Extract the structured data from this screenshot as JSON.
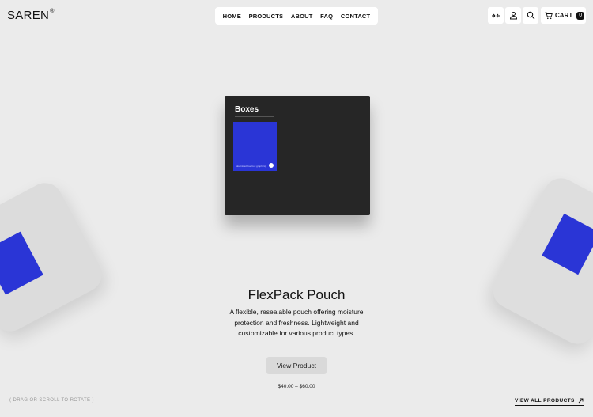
{
  "header": {
    "logo": "SAREN",
    "logo_mark": "®",
    "nav": [
      "HOME",
      "PRODUCTS",
      "ABOUT",
      "FAQ",
      "CONTACT"
    ],
    "icons": [
      "collapse-arrows-icon",
      "user-icon",
      "search-icon"
    ],
    "cart_label": "CART",
    "cart_count": "0"
  },
  "product_box": {
    "title": "Boxes",
    "card_text": "[download free\nbox graphics]"
  },
  "product": {
    "name": "FlexPack Pouch",
    "description": "A flexible, resealable pouch offering moisture protection and freshness. Lightweight and customizable for various product types.",
    "button_label": "View Product",
    "price_range": "$40.00 – $60.00"
  },
  "footer": {
    "hint": "( DRAG OR SCROLL TO ROTATE )",
    "view_all": "VIEW ALL PRODUCTS"
  },
  "colors": {
    "accent_blue": "#2a35d6",
    "background": "#ebebeb",
    "box_dark": "#262626"
  }
}
